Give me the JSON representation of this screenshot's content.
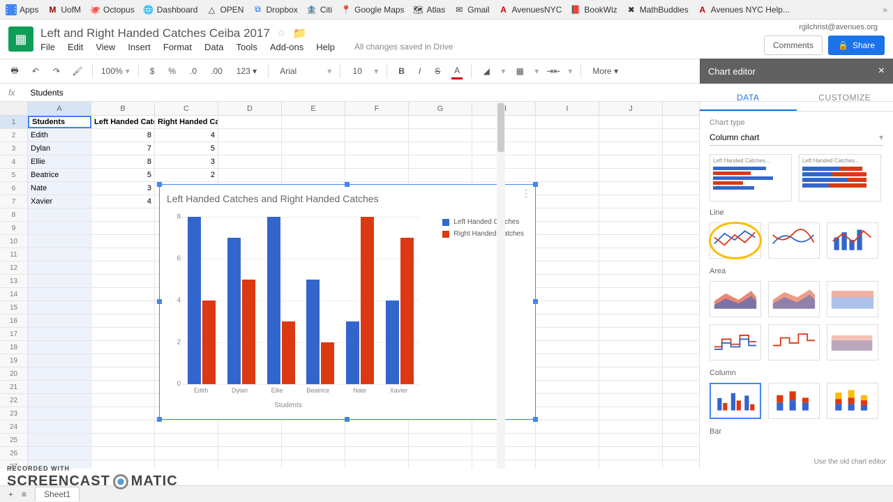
{
  "bookmarks": [
    "Apps",
    "UofM",
    "Octopus",
    "Dashboard",
    "OPEN",
    "Dropbox",
    "Citi",
    "Google Maps",
    "Atlas",
    "Gmail",
    "AvenuesNYC",
    "BookWiz",
    "MathBuddies",
    "Avenues NYC Help..."
  ],
  "doc_title": "Left and Right Handed Catches Ceiba 2017",
  "account_email": "rgilchrist@avenues.org",
  "comments_label": "Comments",
  "share_label": "Share",
  "menus": [
    "File",
    "Edit",
    "View",
    "Insert",
    "Format",
    "Data",
    "Tools",
    "Add-ons",
    "Help"
  ],
  "save_status": "All changes saved in Drive",
  "toolbar": {
    "zoom": "100%",
    "currency": "$",
    "percent": "%",
    "dec_dec": ".0",
    "dec_inc": ".00",
    "numfmt": "123",
    "font": "Arial",
    "size": "10",
    "more": "More"
  },
  "fx_value": "Students",
  "columns": [
    "A",
    "B",
    "C",
    "D",
    "E",
    "F",
    "G",
    "H",
    "I",
    "J"
  ],
  "rows_count": 27,
  "table": {
    "headers": [
      "Students",
      "Left Handed Catches",
      "Right Handed Catches"
    ],
    "rows": [
      {
        "name": "Edith",
        "l": 8,
        "r": 4
      },
      {
        "name": "Dylan",
        "l": 7,
        "r": 5
      },
      {
        "name": "Ellie",
        "l": 8,
        "r": 3
      },
      {
        "name": "Beatrice",
        "l": 5,
        "r": 2
      },
      {
        "name": "Nate",
        "l": 3,
        "r": ""
      },
      {
        "name": "Xavier",
        "l": 4,
        "r": ""
      }
    ]
  },
  "chart_data": {
    "type": "bar",
    "title": "Left Handed Catches and Right Handed Catches",
    "xlabel": "Students",
    "ylabel": "",
    "ylim": [
      0,
      8
    ],
    "yticks": [
      0,
      2,
      4,
      6,
      8
    ],
    "categories": [
      "Edith",
      "Dylan",
      "Ellie",
      "Beatrice",
      "Nate",
      "Xavier"
    ],
    "series": [
      {
        "name": "Left Handed Catches",
        "color": "#3366cc",
        "values": [
          8,
          7,
          8,
          5,
          3,
          4
        ]
      },
      {
        "name": "Right Handed Catches",
        "color": "#dc3912",
        "values": [
          4,
          5,
          3,
          2,
          8,
          7
        ]
      }
    ]
  },
  "editor": {
    "title": "Chart editor",
    "tab_data": "DATA",
    "tab_customize": "CUSTOMIZE",
    "chart_type_label": "Chart type",
    "chart_type_value": "Column chart",
    "preview_caption": "Left Handed Catches...",
    "section_line": "Line",
    "section_area": "Area",
    "section_column": "Column",
    "section_bar": "Bar",
    "footer": "Use the old chart editor"
  },
  "sheet_tab": "Sheet1",
  "watermark_top": "RECORDED WITH",
  "watermark_a": "SCREENCAST",
  "watermark_b": "MATIC"
}
